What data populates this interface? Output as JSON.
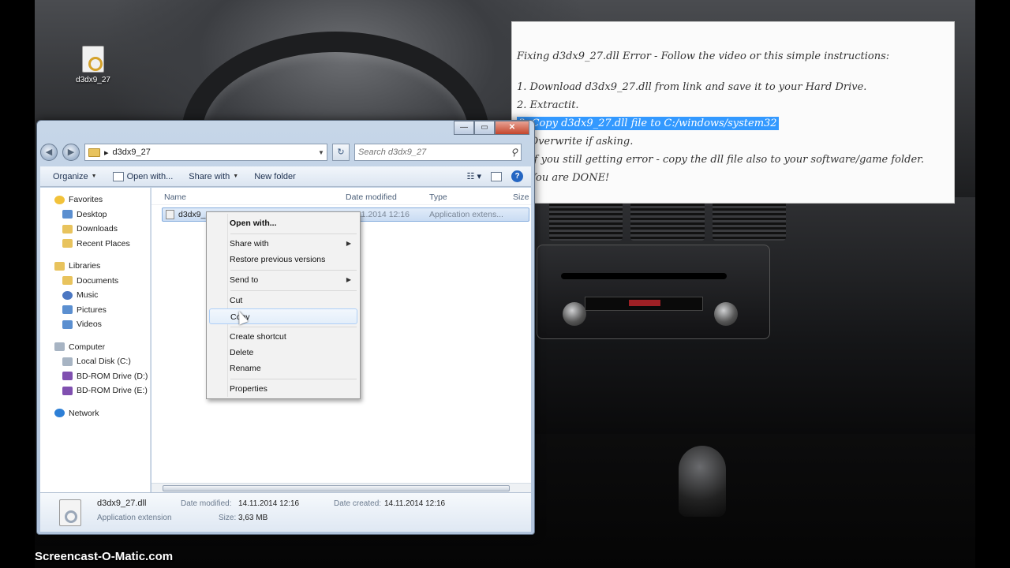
{
  "desktop": {
    "icon_label": "d3dx9_27"
  },
  "instructions": {
    "title": "Fixing d3dx9_27.dll Error - Follow the video or this simple instructions:",
    "steps": [
      "1. Download d3dx9_27.dll from link and save it to your Hard Drive.",
      "2. Extractit.",
      "3. Copy d3dx9_27.dll file to C:/windows/system32",
      "4. Overwrite if asking.",
      "5. If you still getting error - copy the dll file also to your software/game folder.",
      "6. You are DONE!"
    ],
    "highlight_color": "#3399ff"
  },
  "explorer": {
    "address": {
      "arrow": "▸",
      "path": "d3dx9_27"
    },
    "search_placeholder": "Search d3dx9_27",
    "toolbar": {
      "organize": "Organize",
      "open_with": "Open with...",
      "share_with": "Share with",
      "new_folder": "New folder"
    },
    "nav": {
      "favorites": "Favorites",
      "desktop": "Desktop",
      "downloads": "Downloads",
      "recent_places": "Recent Places",
      "libraries": "Libraries",
      "documents": "Documents",
      "music": "Music",
      "pictures": "Pictures",
      "videos": "Videos",
      "computer": "Computer",
      "local_disk": "Local Disk (C:)",
      "bd_rom_d": "BD-ROM Drive (D:) V",
      "bd_rom_e": "BD-ROM Drive (E:) V",
      "network": "Network"
    },
    "columns": {
      "name": "Name",
      "date_modified": "Date modified",
      "type": "Type",
      "size": "Size"
    },
    "file": {
      "name": "d3dx9_27",
      "date_modified": "14.11.2014 12:16",
      "type": "Application extens..."
    },
    "details": {
      "name": "d3dx9_27.dll",
      "type": "Application extension",
      "date_modified_label": "Date modified:",
      "date_modified": "14.11.2014 12:16",
      "date_created_label": "Date created:",
      "date_created": "14.11.2014 12:16",
      "size_label": "Size:",
      "size": "3,63 MB"
    }
  },
  "context_menu": {
    "items": {
      "open_with": "Open with...",
      "share_with": "Share with",
      "restore_previous": "Restore previous versions",
      "send_to": "Send to",
      "cut": "Cut",
      "copy": "Copy",
      "create_shortcut": "Create shortcut",
      "delete": "Delete",
      "rename": "Rename",
      "properties": "Properties"
    },
    "hovered": "copy"
  },
  "watermark": "Screencast-O-Matic.com"
}
